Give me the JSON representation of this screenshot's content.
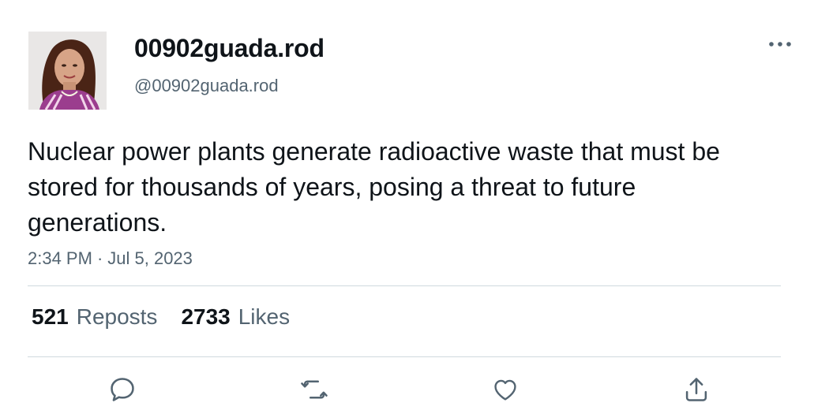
{
  "user": {
    "display_name": "00902guada.rod",
    "handle": "@00902guada.rod"
  },
  "tweet": {
    "text": "Nuclear power plants generate radioactive waste that must be stored for thousands of years, posing a threat to future generations.",
    "time": "2:34 PM",
    "separator": "·",
    "date": "Jul 5, 2023"
  },
  "stats": {
    "reposts_count": "521",
    "reposts_label": "Reposts",
    "likes_count": "2733",
    "likes_label": "Likes"
  },
  "actions": {
    "icons": [
      "reply-icon",
      "repost-icon",
      "like-icon",
      "share-icon"
    ]
  },
  "colors": {
    "text_primary": "#0f1419",
    "text_secondary": "#536471",
    "divider": "#cfd9de"
  }
}
